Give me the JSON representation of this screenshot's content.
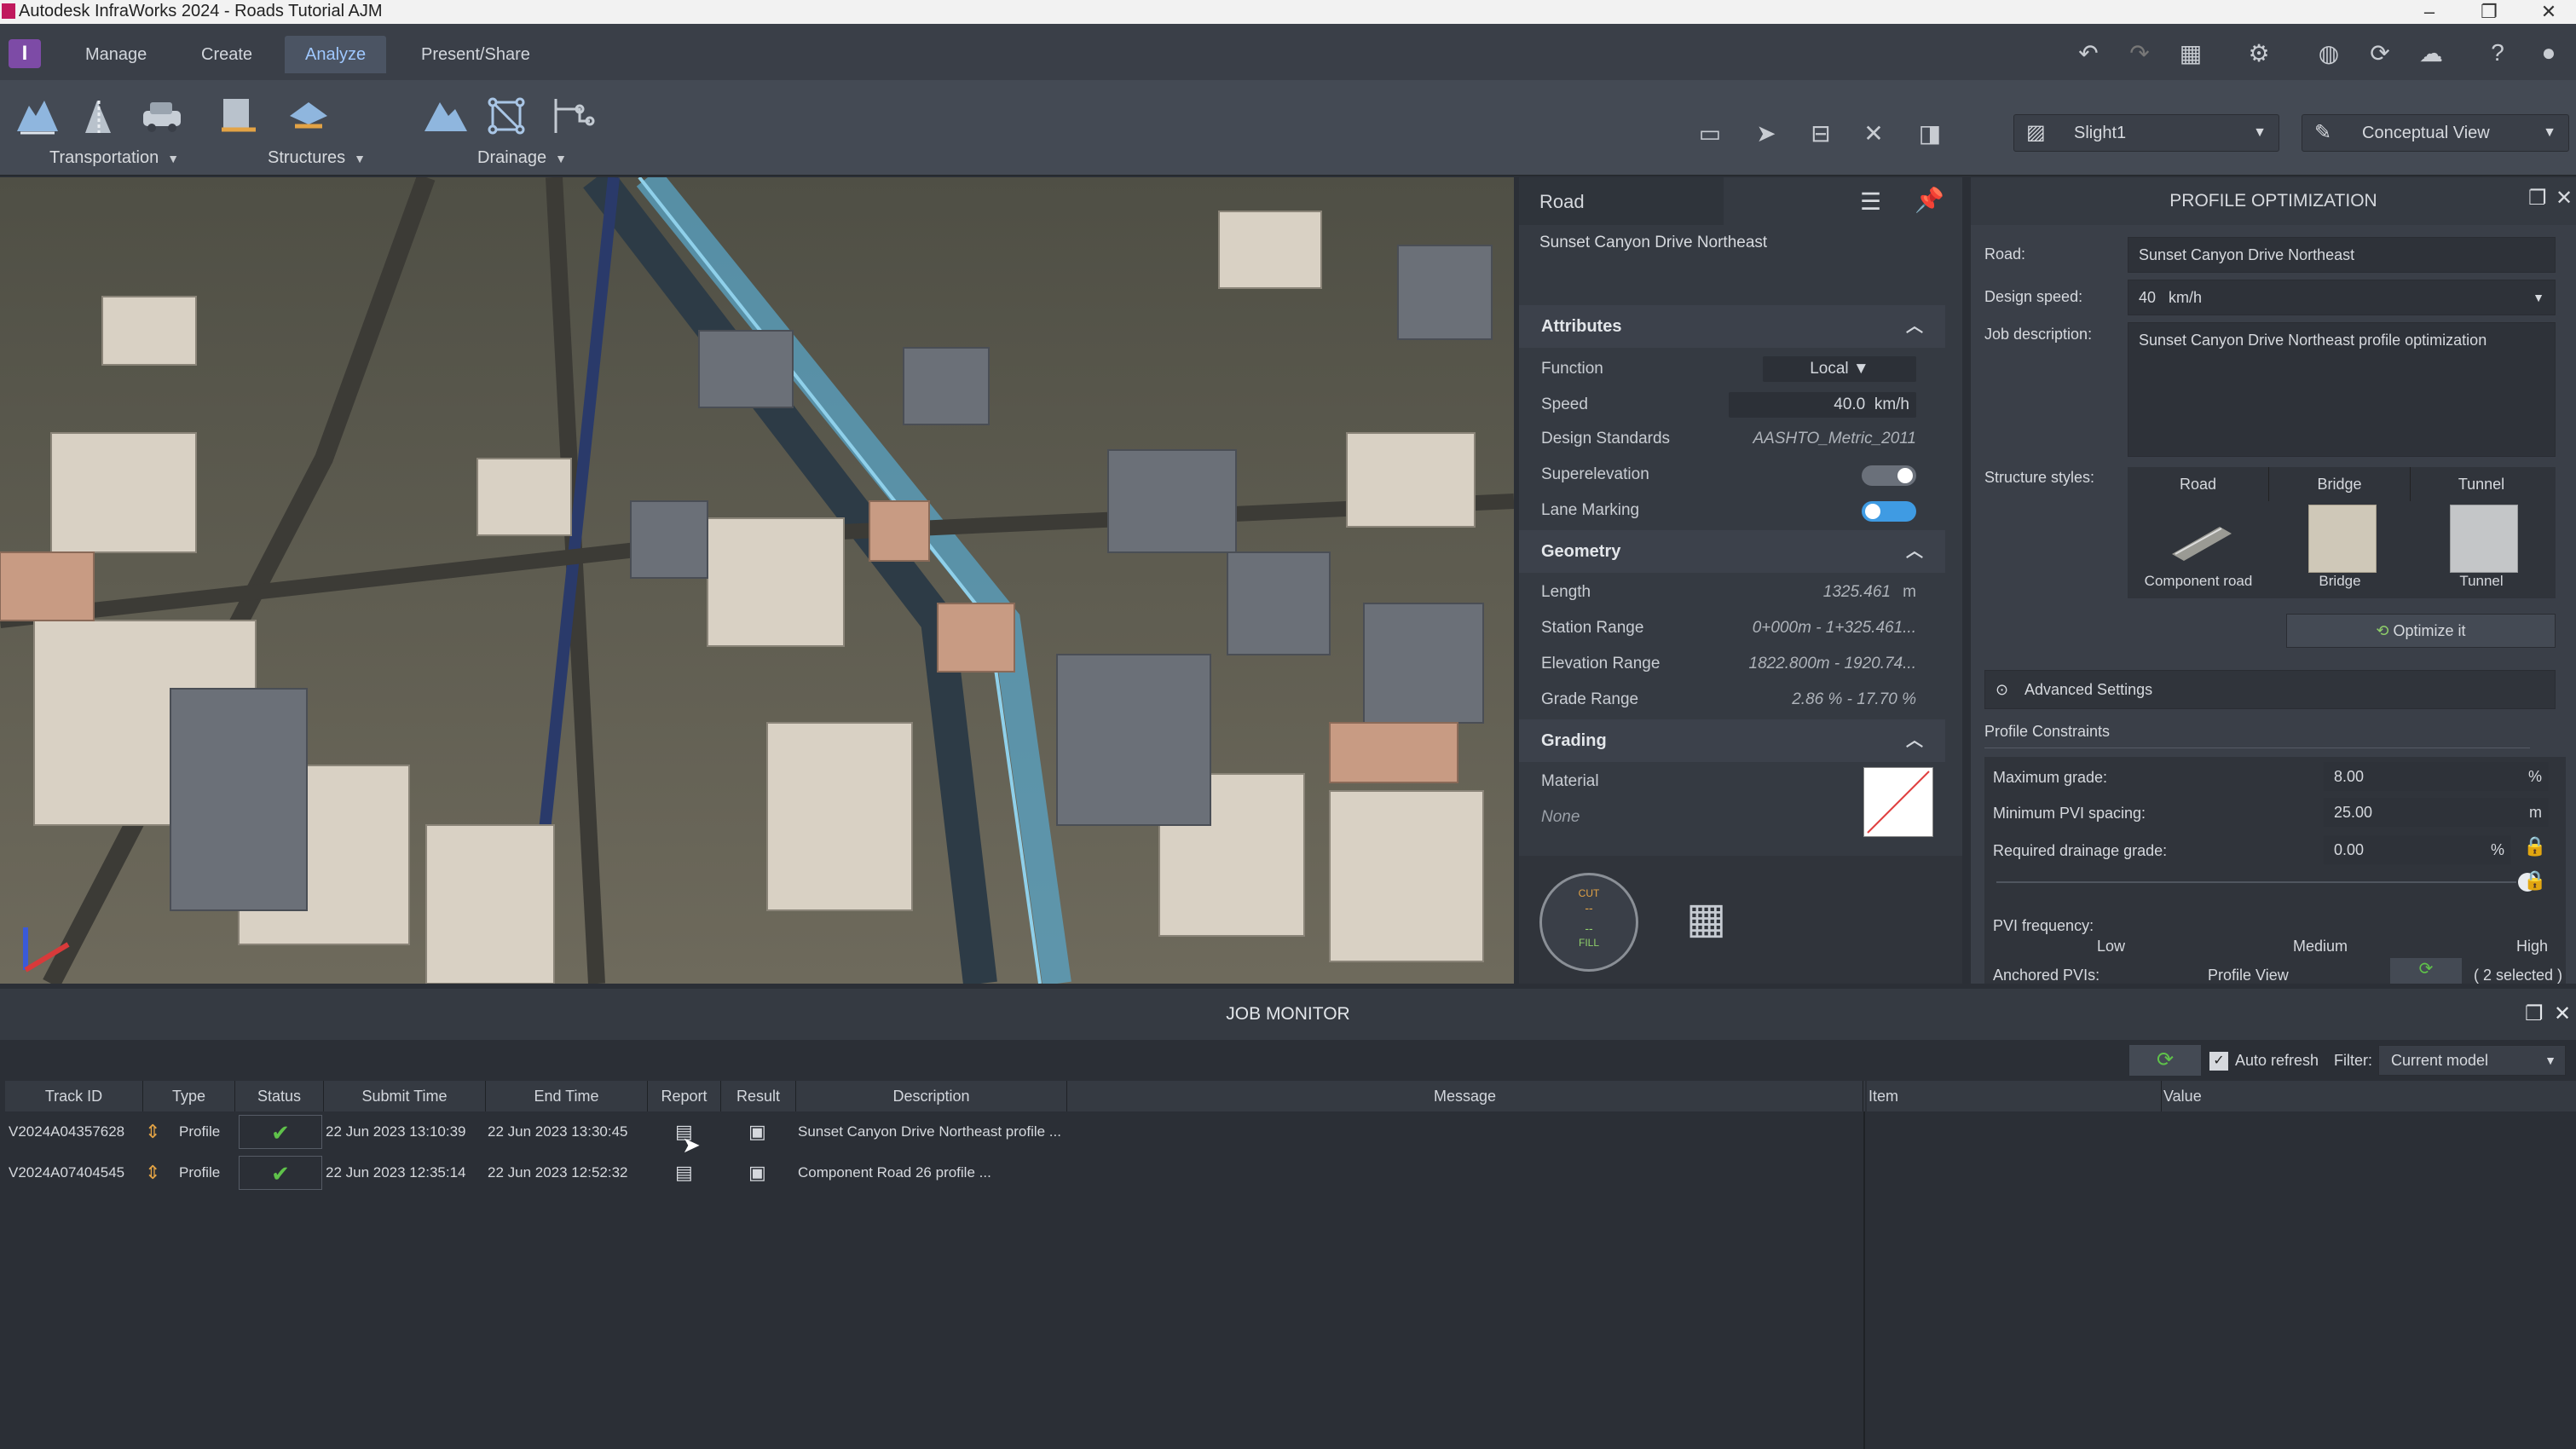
{
  "window": {
    "title": "Autodesk InfraWorks 2024 - Roads Tutorial AJM"
  },
  "app_icon": "I",
  "tabs": [
    {
      "label": "Manage"
    },
    {
      "label": "Create"
    },
    {
      "label": "Analyze"
    },
    {
      "label": "Present/Share"
    }
  ],
  "ribbon": {
    "groups": [
      {
        "label": "Transportation"
      },
      {
        "label": "Structures"
      },
      {
        "label": "Drainage"
      }
    ],
    "view_selector": "Slight1",
    "style_selector": "Conceptual View"
  },
  "road_panel": {
    "title": "Road",
    "road_name": "Sunset Canyon Drive Northeast",
    "attributes_title": "Attributes",
    "attributes": [
      {
        "label": "Function",
        "value": "Local"
      },
      {
        "label": "Speed",
        "value": "40.0",
        "unit": "km/h"
      },
      {
        "label": "Design Standards",
        "value": "AASHTO_Metric_2011"
      },
      {
        "label": "Superelevation",
        "value": "off"
      },
      {
        "label": "Lane Marking",
        "value": "on"
      }
    ],
    "geometry_title": "Geometry",
    "geometry": [
      {
        "label": "Length",
        "value": "1325.461",
        "unit": "m"
      },
      {
        "label": "Station Range",
        "value": "0+000m - 1+325.461..."
      },
      {
        "label": "Elevation Range",
        "value": "1822.800m - 1920.74..."
      },
      {
        "label": "Grade Range",
        "value": "2.86 % - 17.70 %"
      }
    ],
    "grading_title": "Grading",
    "grading": [
      {
        "label": "Material"
      },
      {
        "label": "None"
      }
    ],
    "cut_label": "CUT",
    "fill_label": "FILL",
    "cut_value": "--",
    "fill_value": "--"
  },
  "profile_opt": {
    "title": "PROFILE OPTIMIZATION",
    "road_label": "Road:",
    "road_value": "Sunset Canyon Drive Northeast",
    "speed_label": "Design speed:",
    "speed_value": "40",
    "speed_unit": "km/h",
    "job_label": "Job description:",
    "job_value": "Sunset Canyon Drive Northeast profile optimization",
    "structure_label": "Structure styles:",
    "structure_cols": [
      "Road",
      "Bridge",
      "Tunnel"
    ],
    "structure_items": [
      "Component road",
      "Bridge",
      "Tunnel"
    ],
    "optimize_label": "Optimize it",
    "advanced_label": "Advanced Settings",
    "constraints_tab": "Profile Constraints",
    "max_grade_label": "Maximum grade:",
    "max_grade_value": "8.00",
    "max_grade_unit": "%",
    "min_pvi_label": "Minimum PVI spacing:",
    "min_pvi_value": "25.00",
    "min_pvi_unit": "m",
    "drain_label": "Required drainage grade:",
    "drain_value": "0.00",
    "drain_unit": "%",
    "pvi_freq_label": "PVI frequency:",
    "pvi_freq_low": "Low",
    "pvi_freq_med": "Medium",
    "pvi_freq_high": "High",
    "anchored_label": "Anchored PVIs:",
    "anchored_view": "Profile View",
    "anchored_count": "( 2 selected )"
  },
  "job_monitor": {
    "title": "JOB MONITOR",
    "auto_refresh": "Auto refresh",
    "filter_label": "Filter:",
    "filter_value": "Current model",
    "columns": [
      "Track ID",
      "Type",
      "Status",
      "Submit Time",
      "End Time",
      "Report",
      "Result",
      "Description",
      "Message"
    ],
    "detail_columns": [
      "Item",
      "Value"
    ],
    "rows": [
      {
        "track_id": "V2024A04357628",
        "type": "Profile",
        "submit": "22 Jun 2023 13:10:39",
        "end": "22 Jun 2023 13:30:45",
        "description": "Sunset Canyon Drive Northeast profile ..."
      },
      {
        "track_id": "V2024A07404545",
        "type": "Profile",
        "submit": "22 Jun 2023 12:35:14",
        "end": "22 Jun 2023 12:52:32",
        "description": "Component Road 26 profile ..."
      }
    ]
  },
  "colors": {
    "accent": "#9fc8ff",
    "toggle_on": "#3f9be3",
    "app_icon": "#7d4ba6",
    "success": "#5fc24a",
    "title_icon": "#c0195d"
  }
}
